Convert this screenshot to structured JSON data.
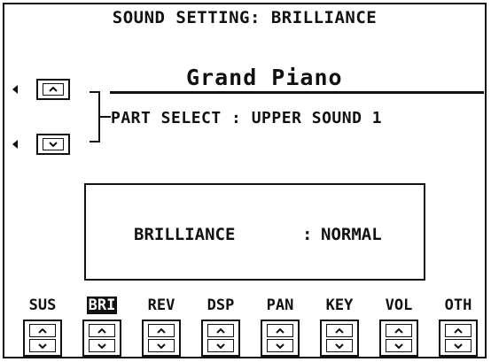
{
  "header": {
    "title": "SOUND SETTING: BRILLIANCE"
  },
  "sound": {
    "name": "Grand Piano"
  },
  "part_select": {
    "text": "PART SELECT : UPPER SOUND 1"
  },
  "parameter": {
    "label": "BRILLIANCE",
    "separator": ":",
    "value": "NORMAL"
  },
  "tabs": [
    {
      "label": "SUS",
      "active": false
    },
    {
      "label": "BRI",
      "active": true
    },
    {
      "label": "REV",
      "active": false
    },
    {
      "label": "DSP",
      "active": false
    },
    {
      "label": "PAN",
      "active": false
    },
    {
      "label": "KEY",
      "active": false
    },
    {
      "label": "VOL",
      "active": false
    },
    {
      "label": "OTH",
      "active": false
    }
  ],
  "icons": {
    "up": "chevron-up-icon",
    "down": "chevron-down-icon",
    "pointer": "left-arrow-icon"
  }
}
